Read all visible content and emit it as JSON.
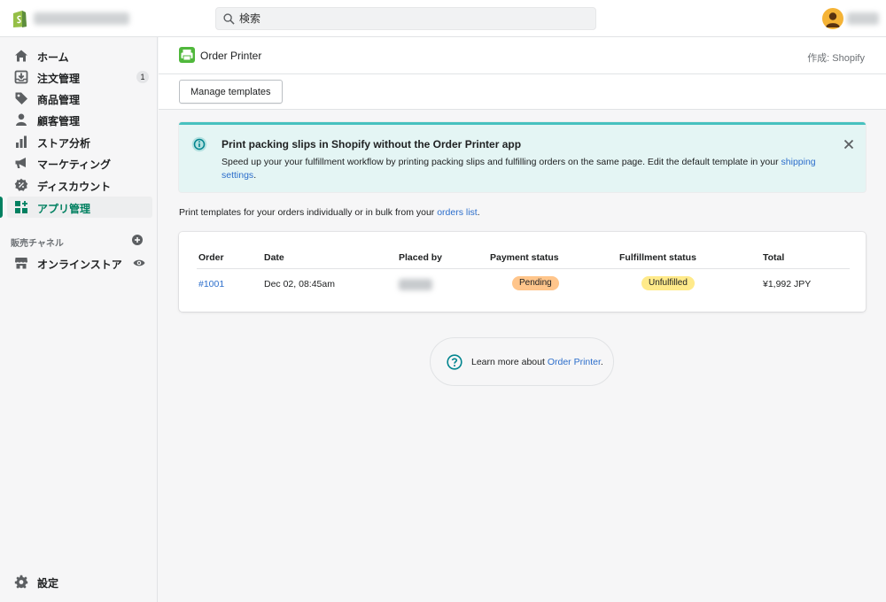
{
  "topbar": {
    "search": {
      "placeholder": "検索",
      "value": ""
    }
  },
  "sidebar": {
    "items": [
      {
        "label": "ホーム",
        "icon": "home-icon"
      },
      {
        "label": "注文管理",
        "icon": "orders-icon",
        "badge": "1"
      },
      {
        "label": "商品管理",
        "icon": "tag-icon"
      },
      {
        "label": "顧客管理",
        "icon": "person-icon"
      },
      {
        "label": "ストア分析",
        "icon": "bar-chart-icon"
      },
      {
        "label": "マーケティング",
        "icon": "megaphone-icon"
      },
      {
        "label": "ディスカウント",
        "icon": "discount-icon"
      },
      {
        "label": "アプリ管理",
        "icon": "apps-icon",
        "active": true
      }
    ],
    "sales_channels_title": "販売チャネル",
    "online_store_label": "オンラインストア",
    "settings_label": "設定"
  },
  "app": {
    "title": "Order Printer",
    "by": "作成: Shopify",
    "manage_templates": "Manage templates"
  },
  "banner": {
    "title": "Print packing slips in Shopify without the Order Printer app",
    "text": "Speed up your your fulfillment workflow by printing packing slips and fulfilling orders on the same page. Edit the default template in your ",
    "link": "shipping settings",
    "end": "."
  },
  "intro": {
    "text": "Print templates for your orders individually or in bulk from your ",
    "link": "orders list",
    "end": "."
  },
  "table": {
    "headers": [
      "Order",
      "Date",
      "Placed by",
      "Payment status",
      "Fulfillment status",
      "Total"
    ],
    "rows": [
      {
        "order": "#1001",
        "date": "Dec 02, 08:45am",
        "payment": "Pending",
        "fulfillment": "Unfulfilled",
        "total": "¥1,992 JPY"
      }
    ]
  },
  "learn": {
    "text": "Learn more about ",
    "link": "Order Printer",
    "end": "."
  },
  "colors": {
    "brand_green": "#008060",
    "banner_bg": "#e4f5f4",
    "banner_border": "#47c1bf",
    "pending": "#ffc58b",
    "unfulfilled": "#ffea8a",
    "link": "#2c6ecb"
  }
}
